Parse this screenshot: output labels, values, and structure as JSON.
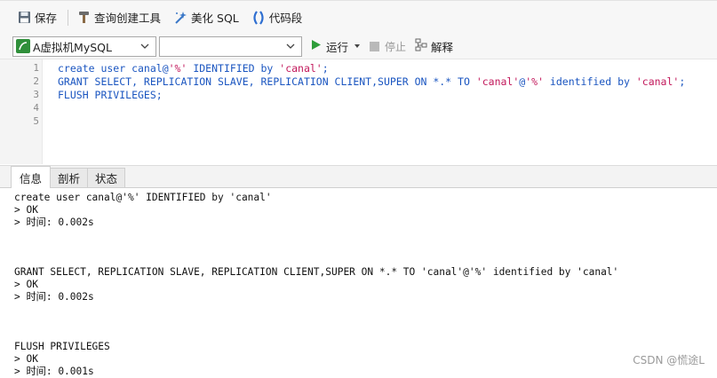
{
  "toolbar": {
    "save_label": "保存",
    "query_builder_label": "查询创建工具",
    "beautify_label": "美化 SQL",
    "snippet_label": "代码段"
  },
  "connection": {
    "selected": "A虚拟机MySQL",
    "database_selected": ""
  },
  "actions": {
    "run_label": "运行",
    "stop_label": "停止",
    "explain_label": "解释"
  },
  "editor": {
    "line_numbers": [
      "1",
      "2",
      "3",
      "4",
      "5"
    ],
    "lines": [
      [
        {
          "t": "create user canal@",
          "c": "pl"
        },
        {
          "t": "'%'",
          "c": "str"
        },
        {
          "t": " IDENTIFIED by ",
          "c": "pl"
        },
        {
          "t": "'canal'",
          "c": "str"
        },
        {
          "t": ";",
          "c": "pl"
        }
      ],
      [
        {
          "t": "GRANT SELECT, REPLICATION SLAVE, REPLICATION CLIENT,SUPER ON *.* TO ",
          "c": "pl"
        },
        {
          "t": "'canal'",
          "c": "str"
        },
        {
          "t": "@",
          "c": "pl"
        },
        {
          "t": "'%'",
          "c": "str"
        },
        {
          "t": " identified by ",
          "c": "pl"
        },
        {
          "t": "'canal'",
          "c": "str"
        },
        {
          "t": ";",
          "c": "pl"
        }
      ],
      [
        {
          "t": "FLUSH PRIVILEGES;",
          "c": "pl"
        }
      ],
      [],
      []
    ]
  },
  "tabs": [
    {
      "label": "信息",
      "active": true
    },
    {
      "label": "剖析",
      "active": false
    },
    {
      "label": "状态",
      "active": false
    }
  ],
  "results": [
    {
      "statement": "create user canal@'%' IDENTIFIED by 'canal'",
      "status": "> OK",
      "time": "> 时间: 0.002s"
    },
    {
      "statement": "GRANT SELECT, REPLICATION SLAVE, REPLICATION CLIENT,SUPER ON *.* TO 'canal'@'%' identified by 'canal'",
      "status": "> OK",
      "time": "> 时间: 0.002s"
    },
    {
      "statement": "FLUSH PRIVILEGES",
      "status": "> OK",
      "time": "> 时间: 0.001s"
    }
  ],
  "watermark": "CSDN @慌途L",
  "colors": {
    "keyword": "#1a55c0",
    "string": "#c2185b",
    "run_green": "#2e9d3a"
  }
}
